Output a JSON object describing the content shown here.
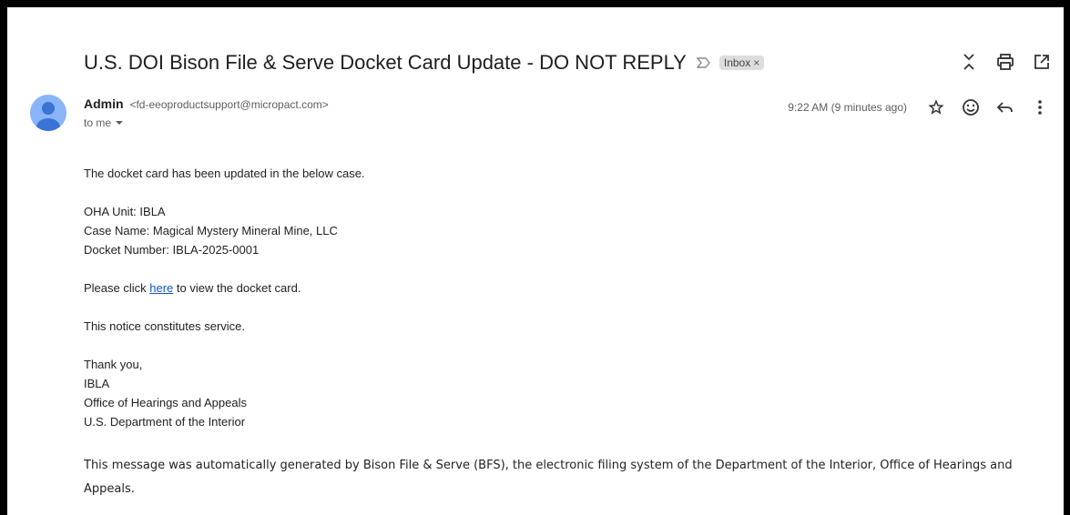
{
  "email": {
    "subject": "U.S. DOI Bison File & Serve Docket Card Update - DO NOT REPLY",
    "label_chip": "Inbox",
    "label_chip_close": "×",
    "sender_name": "Admin",
    "sender_email": "<fd-eeoproductsupport@micropact.com>",
    "to_line": "to me",
    "timestamp": "9:22 AM (9 minutes ago)"
  },
  "icons": {
    "important": "important-marker-icon",
    "collapse": "collapse-all-icon",
    "print": "print-icon",
    "popout": "open-new-window-icon",
    "star": "star-icon",
    "emoji": "emoji-icon",
    "reply": "reply-icon",
    "more": "more-vert-icon",
    "to_dropdown": "chevron-down-icon",
    "avatar": "default-avatar-icon"
  },
  "body": {
    "intro": "The docket card has been updated in the below case.",
    "oha_unit": "OHA Unit: IBLA",
    "case_name": "Case Name: Magical Mystery Mineral Mine, LLC",
    "docket_number": "Docket Number: IBLA-2025-0001",
    "click_prefix": "Please click ",
    "click_link": "here",
    "click_suffix": " to view the docket card.",
    "notice": "This notice constitutes service.",
    "thanks": "Thank you,",
    "sig_unit": "IBLA",
    "sig_office": "Office of Hearings and Appeals",
    "sig_dept": "U.S. Department of the Interior",
    "footer": "This message was automatically generated by Bison File & Serve (BFS), the electronic filing system of the Department of the Interior, Office of Hearings and Appeals."
  },
  "colors": {
    "link": "#1155cc",
    "avatar_bg": "#8ab4f8",
    "avatar_fg": "#3a72d6",
    "chip_bg": "#dddddd"
  }
}
